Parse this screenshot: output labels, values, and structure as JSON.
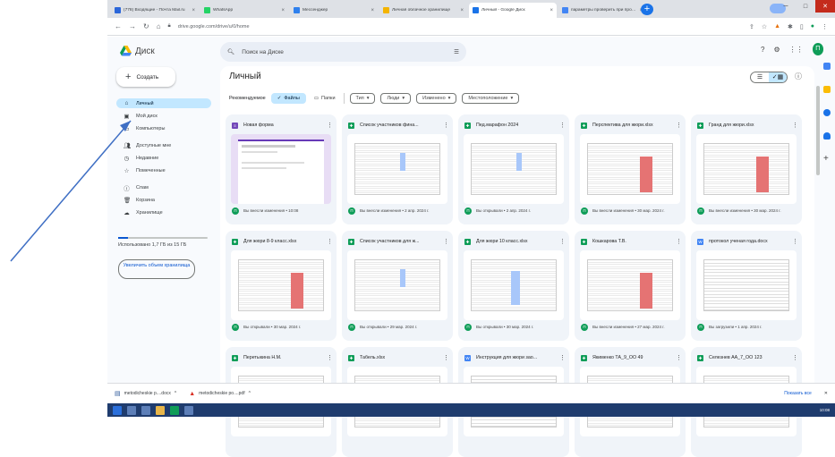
{
  "browser": {
    "tabs": [
      {
        "label": "(778) Входящие - Почта Mail.ru",
        "color": "#2b66d9"
      },
      {
        "label": "WhatsApp",
        "color": "#25d366"
      },
      {
        "label": "Мессенджер",
        "color": "#2f80ed"
      },
      {
        "label": "Личная облачное хранилище",
        "color": "#f4b400"
      },
      {
        "label": "Личный - Google Диск",
        "color": "#1a73e8",
        "active": true
      },
      {
        "label": "параметры проверить при проверить",
        "color": "#4285f4"
      }
    ],
    "new_tab": "+",
    "url": "drive.google.com/drive/u/0/home"
  },
  "drive": {
    "app_name": "Диск",
    "create_label": "Создать",
    "search_placeholder": "Поиск на Диске",
    "nav": [
      {
        "label": "Личный",
        "icon": "home-icon",
        "selected": true
      },
      {
        "label": "Мой диск",
        "icon": "drive-icon"
      },
      {
        "label": "Компьютеры",
        "icon": "computer-icon"
      },
      {
        "label": "Доступные мне",
        "icon": "people-icon"
      },
      {
        "label": "Недавние",
        "icon": "clock-icon"
      },
      {
        "label": "Помеченные",
        "icon": "star-icon"
      },
      {
        "label": "Спам",
        "icon": "spam-icon"
      },
      {
        "label": "Корзина",
        "icon": "trash-icon"
      },
      {
        "label": "Хранилище",
        "icon": "cloud-icon"
      }
    ],
    "storage_text": "Использовано 1,7 ГБ из 15 ГБ",
    "upgrade_label": "Увеличить объем хранилища",
    "page_title": "Личный",
    "filters": {
      "recommended": "Рекомендуемое",
      "files": "Файлы",
      "folders": "Папки",
      "type": "Тип",
      "people": "Люди",
      "modified": "Изменено",
      "location": "Местоположение"
    },
    "files": [
      {
        "name": "Новая форма",
        "type": "form",
        "color": "#7248b9",
        "footer": "Вы внесли изменения • 10:08"
      },
      {
        "name": "Список участников фина...",
        "type": "sheet",
        "color": "#0f9d58",
        "footer": "Вы внесли изменения • 2 апр. 2024 г."
      },
      {
        "name": "Пед.марафон 2024",
        "type": "sheet",
        "color": "#0f9d58",
        "footer": "Вы открывали • 2 апр. 2024 г."
      },
      {
        "name": "Перспектива для жюри.xlsx",
        "type": "sheet-red",
        "color": "#0f9d58",
        "footer": "Вы внесли изменения • 30 мар. 2024 г."
      },
      {
        "name": "Гранд для жюри.xlsx",
        "type": "sheet-red",
        "color": "#0f9d58",
        "footer": "Вы внесли изменения • 30 мар. 2024 г."
      },
      {
        "name": "Для жюри 8-9 класс.xlsx",
        "type": "sheet-red",
        "color": "#0f9d58",
        "footer": "Вы открывали • 30 мар. 2024 г."
      },
      {
        "name": "Список участников для ж...",
        "type": "sheet",
        "color": "#0f9d58",
        "footer": "Вы открывали • 29 мар. 2024 г."
      },
      {
        "name": "Для жюри 10 класс.xlsx",
        "type": "sheet-blue",
        "color": "#0f9d58",
        "footer": "Вы открывали • 30 мар. 2024 г."
      },
      {
        "name": "Кошкарова Т.В.",
        "type": "sheet-red",
        "color": "#0f9d58",
        "footer": "Вы внесли изменения • 27 мар. 2024 г."
      },
      {
        "name": "протокол ученая года.docx",
        "type": "doc",
        "color": "#4285f4",
        "footer": "Вы загрузили • 1 апр. 2024 г."
      },
      {
        "name": "Перетыкина Н.М.",
        "type": "sheet",
        "color": "#0f9d58",
        "footer": ""
      },
      {
        "name": "Табель.xlsx",
        "type": "sheet",
        "color": "#0f9d58",
        "footer": ""
      },
      {
        "name": "Инструкция для жюри зао...",
        "type": "doc",
        "color": "#4285f4",
        "footer": ""
      },
      {
        "name": "Якименко ТА_9_ОО 49",
        "type": "sheet-yellow",
        "color": "#0f9d58",
        "footer": ""
      },
      {
        "name": "Селезнев АА_7_ОО 123",
        "type": "sheet-yellow",
        "color": "#0f9d58",
        "footer": ""
      }
    ],
    "avatar_letter": "П",
    "avatar_color": "#0f9d58"
  },
  "downloads": {
    "items": [
      "metodicheskie p....docx",
      "metodicheskie po....pdf"
    ],
    "show_all": "Показать все"
  },
  "taskbar": {
    "clock": "10:08"
  }
}
